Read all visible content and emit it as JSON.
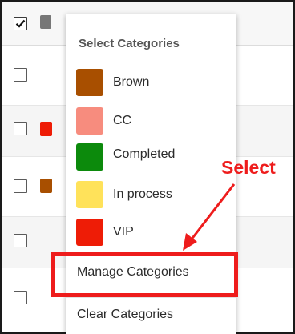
{
  "menu": {
    "title": "Select Categories",
    "categories": [
      {
        "label": "Brown",
        "color": "#a84f00"
      },
      {
        "label": "CC",
        "color": "#f78c7e"
      },
      {
        "label": "Completed",
        "color": "#0c8a0c"
      },
      {
        "label": "In process",
        "color": "#ffe25a"
      },
      {
        "label": "VIP",
        "color": "#ee1c06"
      }
    ],
    "manage_label": "Manage Categories",
    "clear_label": "Clear Categories"
  },
  "list": {
    "header_checked": true,
    "row_tags": [
      null,
      "#ee1c06",
      "#a84f00",
      null,
      null
    ]
  },
  "annotation": {
    "text": "Select",
    "color": "#ee1c1c"
  }
}
